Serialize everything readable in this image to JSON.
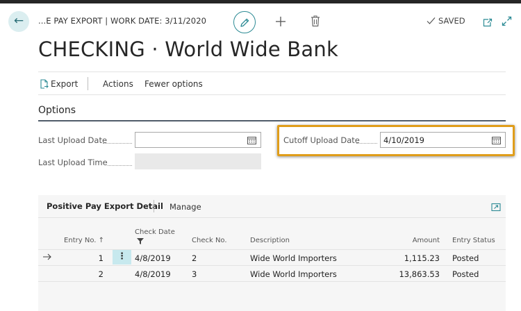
{
  "header": {
    "breadcrumb": "...E PAY EXPORT | WORK DATE: 3/11/2020",
    "saved_label": "SAVED",
    "title": "CHECKING · World Wide Bank"
  },
  "actions": {
    "export": "Export",
    "actions": "Actions",
    "fewer_options": "Fewer options"
  },
  "options": {
    "section_title": "Options",
    "last_upload_date": {
      "label": "Last Upload Date",
      "value": ""
    },
    "last_upload_time": {
      "label": "Last Upload Time",
      "value": ""
    },
    "cutoff_upload_date": {
      "label": "Cutoff Upload Date",
      "value": "4/10/2019"
    }
  },
  "detail": {
    "title": "Positive Pay Export Detail",
    "manage": "Manage",
    "columns": {
      "entry_no": "Entry No. ↑",
      "check_date": "Check Date",
      "check_no": "Check No.",
      "description": "Description",
      "amount": "Amount",
      "entry_status": "Entry Status"
    },
    "rows": [
      {
        "entry_no": "1",
        "check_date": "4/8/2019",
        "check_no": "2",
        "description": "Wide World Importers",
        "amount": "1,115.23",
        "entry_status": "Posted"
      },
      {
        "entry_no": "2",
        "check_date": "4/8/2019",
        "check_no": "3",
        "description": "Wide World Importers",
        "amount": "13,863.53",
        "entry_status": "Posted"
      }
    ]
  },
  "colors": {
    "accent": "#2b8a94",
    "highlight": "#e09d1a",
    "selected_cell": "#c7e9ee"
  }
}
